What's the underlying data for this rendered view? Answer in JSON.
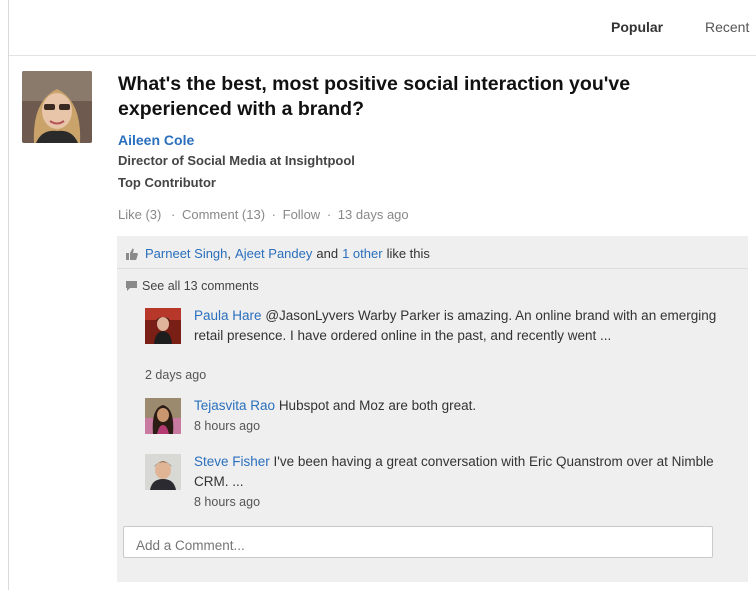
{
  "tabs": {
    "popular": "Popular",
    "recent": "Recent"
  },
  "post": {
    "title": "What's the best, most positive social interaction you've experienced with a brand?",
    "author": "Aileen Cole",
    "headline": "Director of Social Media at Insightpool",
    "badge": "Top Contributor",
    "actions": {
      "like": "Like (3)",
      "comment": "Comment (13)",
      "follow": "Follow",
      "age": "13 days ago",
      "separator": "·"
    }
  },
  "likes": {
    "user1": "Parneet Singh",
    "comma": ",",
    "user2": "Ajeet Pandey",
    "and": "and",
    "others": "1 other",
    "suffix": "like this"
  },
  "see_all": "See all 13 comments",
  "comments": [
    {
      "author": "Paula Hare",
      "text": "@JasonLyvers Warby Parker is amazing. An online brand with an emerging retail presence. I have ordered online in the past, and recently went ...",
      "time": "2 days ago"
    },
    {
      "author": "Tejasvita Rao",
      "text": "Hubspot and Moz are both great.",
      "time": "8 hours ago"
    },
    {
      "author": "Steve Fisher",
      "text": "I've been having a great conversation with Eric Quanstrom over at Nimble CRM. ...",
      "time": "8 hours ago"
    }
  ],
  "comment_input": {
    "placeholder": "Add a Comment..."
  },
  "colors": {
    "link": "#2a6fbd",
    "panel": "#efefef"
  },
  "icons": [
    "thumbs-up-icon",
    "speech-bubble-icon"
  ]
}
